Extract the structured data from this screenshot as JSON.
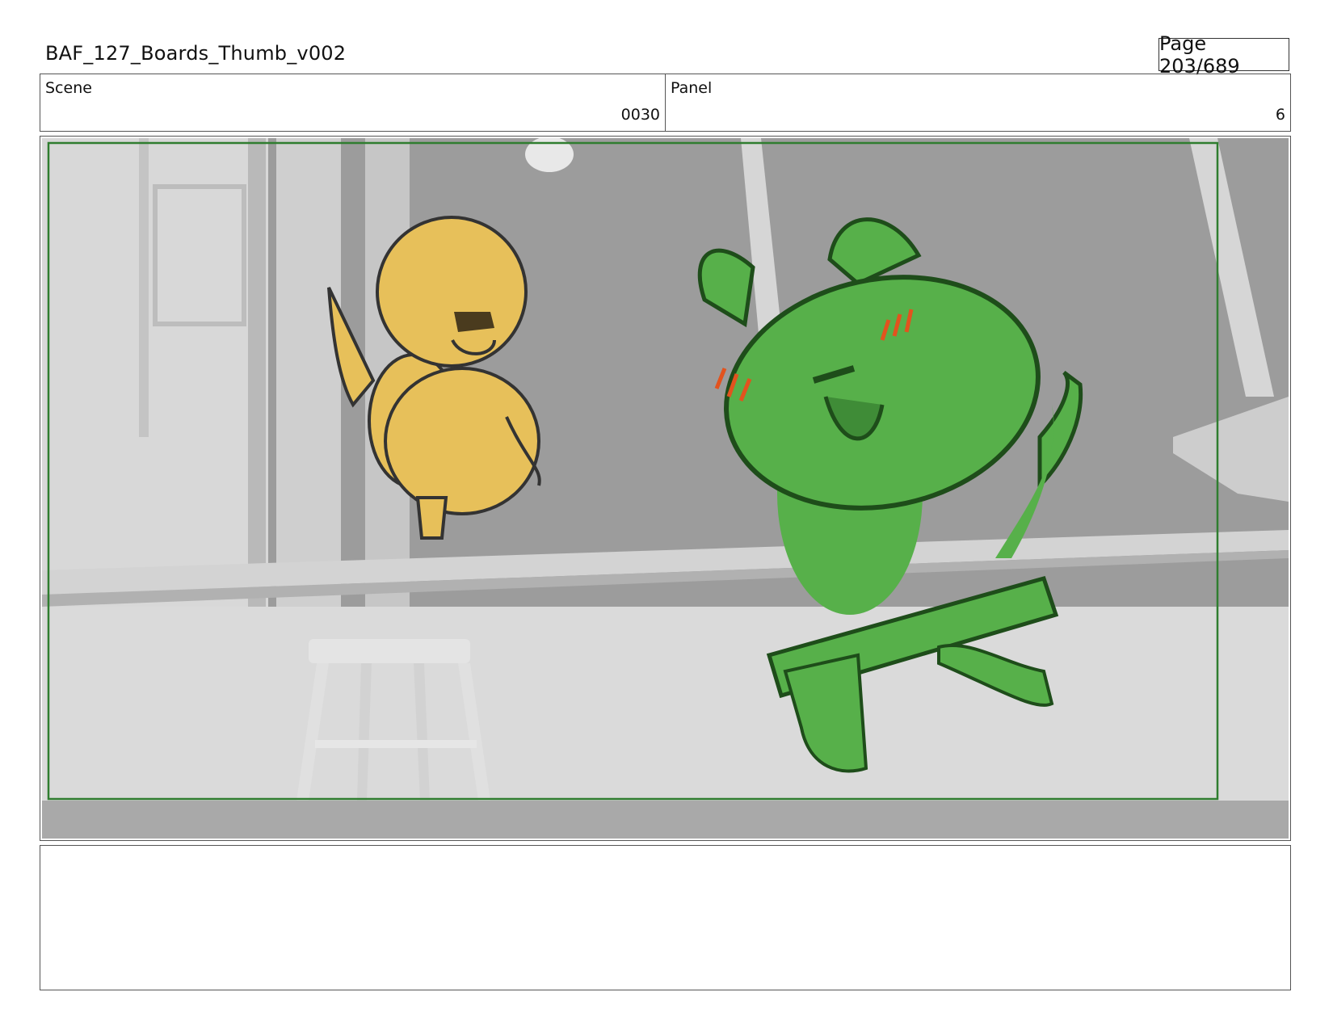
{
  "header": {
    "title": "BAF_127_Boards_Thumb_v002",
    "page_indicator": "Page 203/689"
  },
  "meta": {
    "scene_label": "Scene",
    "scene_value": "0030",
    "panel_label": "Panel",
    "panel_value": "6"
  },
  "panel_image": {
    "description_icon": "storyboard-drawing",
    "safe_frame_color": "#2f7d2f",
    "duck_color": "#e7c05a",
    "bear_color": "#57b04a",
    "blush_color": "#e2531e"
  },
  "notes": {
    "text": ""
  }
}
